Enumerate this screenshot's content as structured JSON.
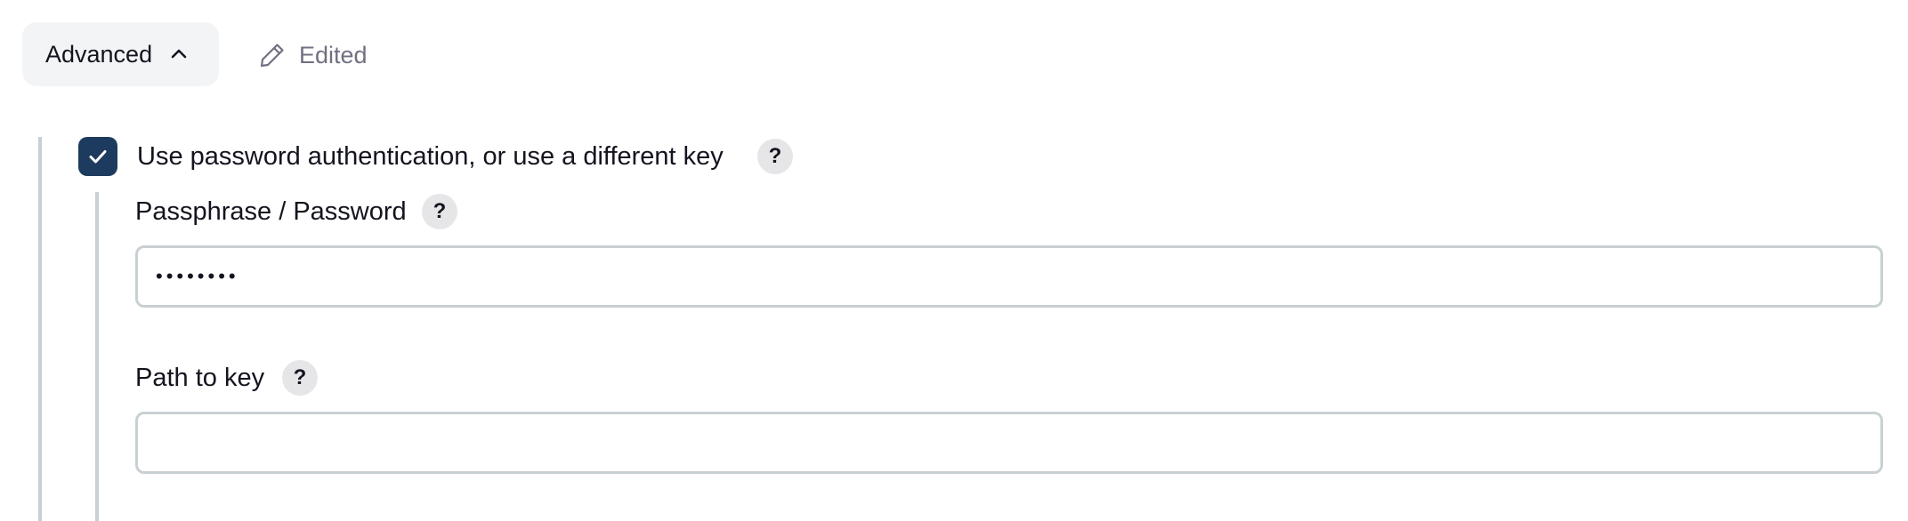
{
  "header": {
    "advanced_label": "Advanced",
    "advanced_icon": "chevron-up-icon",
    "edited_label": "Edited",
    "edited_icon": "pencil-icon"
  },
  "auth_option": {
    "checkbox_label": "Use password authentication, or use a different key",
    "checked": true,
    "help_label": "?"
  },
  "passphrase": {
    "label": "Passphrase / Password",
    "help_label": "?",
    "value": "••••••••"
  },
  "path_to_key": {
    "label": "Path to key",
    "help_label": "?",
    "value": ""
  },
  "colors": {
    "checkbox_fill": "#1d3b5e",
    "button_bg": "#f3f4f6",
    "border": "#c9d0d3",
    "muted_text": "#707082"
  }
}
